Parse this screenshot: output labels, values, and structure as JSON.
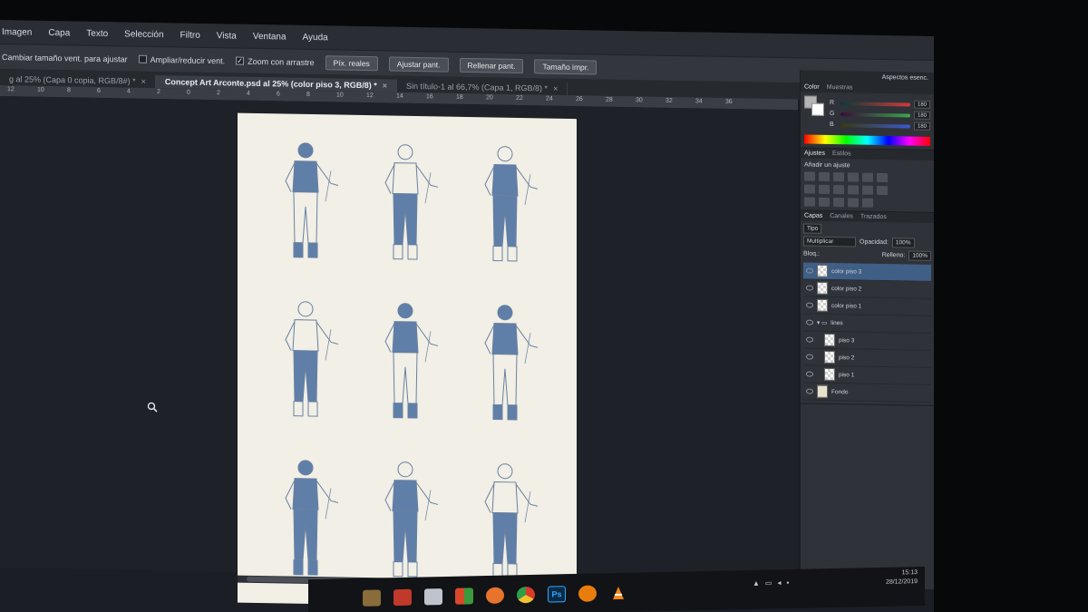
{
  "menu": [
    "Imagen",
    "Capa",
    "Texto",
    "Selección",
    "Filtro",
    "Vista",
    "Ventana",
    "Ayuda"
  ],
  "options": {
    "resize_label": "Cambiar tamaño vent. para ajustar",
    "zoom_resize_label": "Ampliar/reducir vent.",
    "scrubby_label": "Zoom con arrastre",
    "scrubby_checked": "✓",
    "buttons": [
      "Píx. reales",
      "Ajustar pant.",
      "Rellenar pant.",
      "Tamaño impr."
    ]
  },
  "tabs": [
    {
      "label": "g al 25% (Capa 0 copia, RGB/8#) *",
      "close": "×"
    },
    {
      "label": "Concept Art Arconte.psd al 25% (color piso 3, RGB/8) *",
      "close": "×"
    },
    {
      "label": "Sin título-1 al 66,7% (Capa 1, RGB/8) *",
      "close": "×"
    }
  ],
  "ruler_ticks": [
    "12",
    "10",
    "8",
    "6",
    "4",
    "2",
    "0",
    "2",
    "4",
    "6",
    "8",
    "10",
    "12",
    "14",
    "16",
    "18",
    "20",
    "22",
    "24",
    "26",
    "28",
    "30",
    "32",
    "34",
    "36"
  ],
  "workspace_label": "Aspectos esenc.",
  "color_panel": {
    "tabs": [
      "Color",
      "Muestras"
    ],
    "channels": [
      {
        "label": "R",
        "value": "180",
        "color": "#d23a3a"
      },
      {
        "label": "G",
        "value": "180",
        "color": "#3aa84a"
      },
      {
        "label": "B",
        "value": "180",
        "color": "#3a5ad2"
      }
    ]
  },
  "adjust_panel": {
    "tabs": [
      "Ajustes",
      "Estilos"
    ],
    "title": "Añadir un ajuste"
  },
  "layers_panel": {
    "tabs": [
      "Capas",
      "Canales",
      "Trazados"
    ],
    "kind": "Tipo",
    "blend_mode": "Multiplicar",
    "opacity_label": "Opacidad:",
    "opacity": "100%",
    "lock_label": "Bloq.:",
    "fill_label": "Relleno:",
    "fill": "100%",
    "layers": [
      {
        "name": "color piso 3",
        "selected": true,
        "type": "pixel"
      },
      {
        "name": "color piso 2",
        "selected": false,
        "type": "pixel"
      },
      {
        "name": "color piso 1",
        "selected": false,
        "type": "pixel"
      },
      {
        "name": "lines",
        "selected": false,
        "type": "group"
      },
      {
        "name": "piso 3",
        "selected": false,
        "type": "pixel"
      },
      {
        "name": "piso 2",
        "selected": false,
        "type": "pixel"
      },
      {
        "name": "piso 1",
        "selected": false,
        "type": "pixel"
      },
      {
        "name": "Fondo",
        "selected": false,
        "type": "background"
      }
    ]
  },
  "taskbar": {
    "apps": [
      "file-explorer-icon",
      "store-icon",
      "mail-icon",
      "office-icon",
      "firefox-icon",
      "chrome-icon",
      "photoshop-icon",
      "blender-icon",
      "vlc-icon"
    ],
    "ps_label": "Ps",
    "time": "15:13",
    "date": "28/12/2019"
  },
  "colors": {
    "accent": "#3f5f86",
    "figure_blue": "#5f7fa8",
    "paper": "#f1efe6"
  }
}
